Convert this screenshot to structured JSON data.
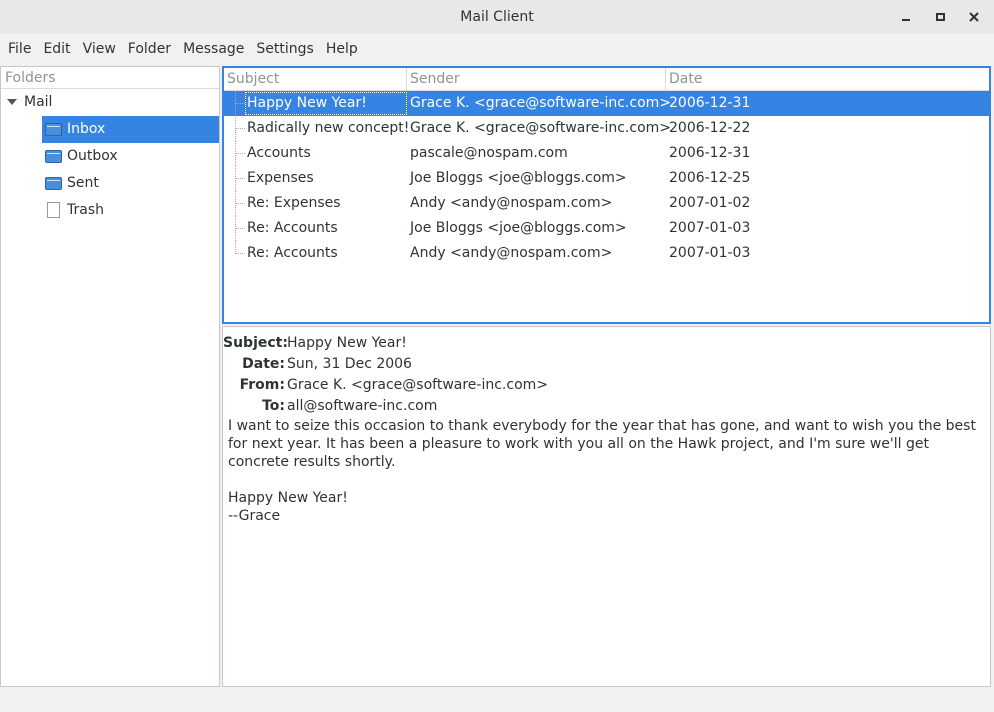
{
  "window": {
    "title": "Mail Client"
  },
  "menubar": {
    "items": [
      "File",
      "Edit",
      "View",
      "Folder",
      "Message",
      "Settings",
      "Help"
    ]
  },
  "folders": {
    "header": "Folders",
    "root": "Mail",
    "items": [
      {
        "label": "Inbox",
        "icon": "folder-icon",
        "selected": true
      },
      {
        "label": "Outbox",
        "icon": "folder-icon"
      },
      {
        "label": "Sent",
        "icon": "folder-icon"
      },
      {
        "label": "Trash",
        "icon": "file-icon"
      }
    ]
  },
  "mail_list": {
    "columns": [
      "Subject",
      "Sender",
      "Date"
    ],
    "rows": [
      {
        "subject": "Happy New Year!",
        "sender": "Grace K. <grace@software-inc.com>",
        "date": "2006-12-31",
        "selected": true
      },
      {
        "subject": "Radically new concept!",
        "sender": "Grace K. <grace@software-inc.com>",
        "date": "2006-12-22"
      },
      {
        "subject": "Accounts",
        "sender": "pascale@nospam.com",
        "date": "2006-12-31"
      },
      {
        "subject": "Expenses",
        "sender": "Joe Bloggs <joe@bloggs.com>",
        "date": "2006-12-25"
      },
      {
        "subject": "Re: Expenses",
        "sender": "Andy <andy@nospam.com>",
        "date": "2007-01-02"
      },
      {
        "subject": "Re: Accounts",
        "sender": "Joe Bloggs <joe@bloggs.com>",
        "date": "2007-01-03"
      },
      {
        "subject": "Re: Accounts",
        "sender": "Andy <andy@nospam.com>",
        "date": "2007-01-03"
      }
    ]
  },
  "preview": {
    "subject_label": "Subject:",
    "subject": "Happy New Year!",
    "date_label": "Date:",
    "date": "Sun, 31 Dec 2006",
    "from_label": "From:",
    "from": "Grace K. <grace@software-inc.com>",
    "to_label": "To:",
    "to": "all@software-inc.com",
    "body": "I want to seize this occasion to thank everybody for the year that has gone, and want to wish you the best for next year. It has been a pleasure to work with you all on the Hawk project, and I'm sure we'll get concrete results shortly.\n\nHappy New Year!\n--Grace"
  },
  "colors": {
    "accent": "#3584e4"
  }
}
